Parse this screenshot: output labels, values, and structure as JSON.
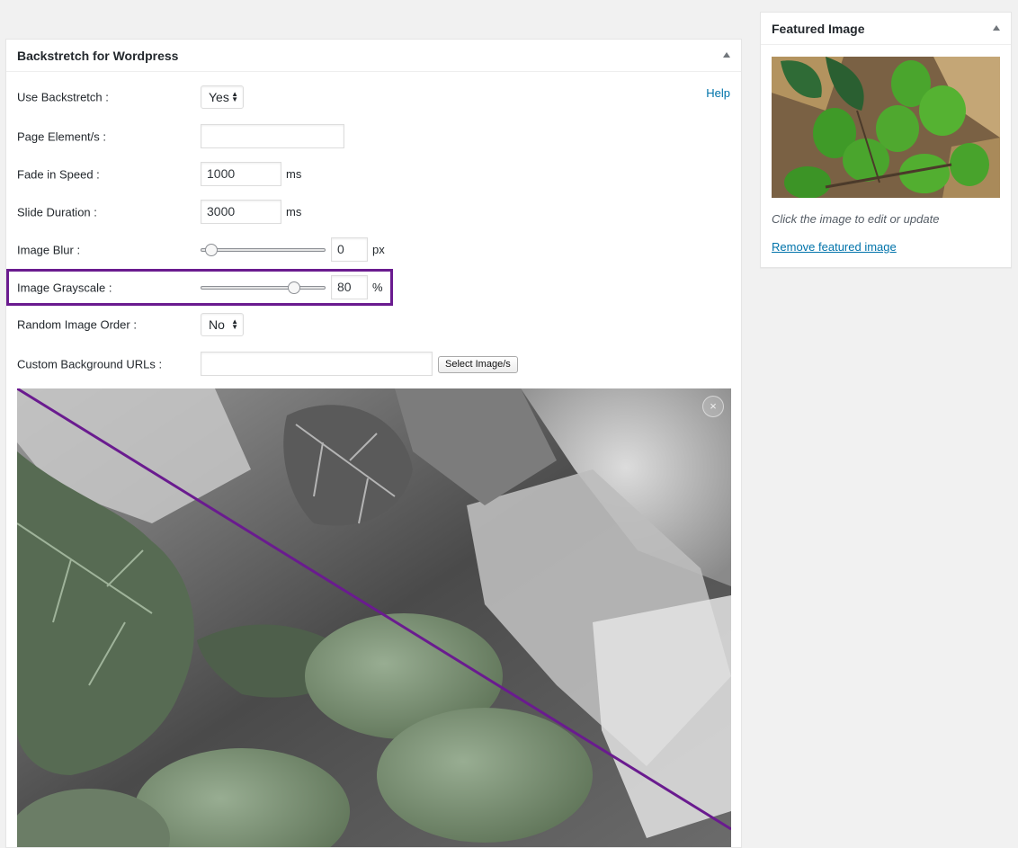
{
  "main_box": {
    "title": "Backstretch for Wordpress",
    "help_label": "Help",
    "fields": {
      "use_backstretch": {
        "label": "Use Backstretch :",
        "value": "Yes"
      },
      "page_elements": {
        "label": "Page Element/s :",
        "value": ""
      },
      "fade_in_speed": {
        "label": "Fade in Speed :",
        "value": "1000",
        "unit": "ms"
      },
      "slide_duration": {
        "label": "Slide Duration :",
        "value": "3000",
        "unit": "ms"
      },
      "image_blur": {
        "label": "Image Blur :",
        "value": "0",
        "unit": "px",
        "slider_fraction": 0.0
      },
      "image_grayscale": {
        "label": "Image Grayscale :",
        "value": "80",
        "unit": "%",
        "slider_fraction": 0.8
      },
      "random_image_order": {
        "label": "Random Image Order :",
        "value": "No"
      },
      "custom_background_urls": {
        "label": "Custom Background URLs :",
        "value": "",
        "button_label": "Select Image/s"
      }
    },
    "preview": {
      "close_symbol": "×"
    }
  },
  "side_box": {
    "title": "Featured Image",
    "caption": "Click the image to edit or update",
    "remove_link": "Remove featured image"
  },
  "colors": {
    "highlight": "#6a1b8f",
    "link": "#0073aa"
  }
}
